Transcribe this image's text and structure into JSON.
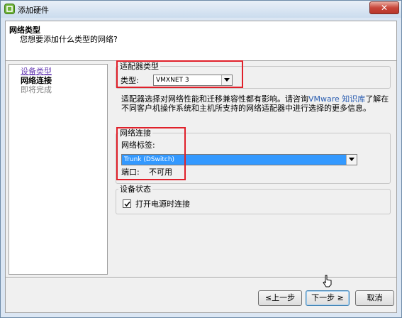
{
  "window": {
    "title": "添加硬件",
    "close_label": "✕"
  },
  "header": {
    "title": "网络类型",
    "subtitle": "您想要添加什么类型的网络?"
  },
  "nav": {
    "items": [
      {
        "label": "设备类型",
        "state": "link"
      },
      {
        "label": "网络连接",
        "state": "current"
      },
      {
        "label": "即将完成",
        "state": "disabled"
      }
    ]
  },
  "adapter": {
    "group_label": "适配器类型",
    "type_label": "类型:",
    "type_value": "VMXNET 3"
  },
  "description": {
    "part1": "适配器选择对网络性能和迁移兼容性都有影响。请咨询",
    "link": "VMware 知识库",
    "part2": "了解在不同客户机操作系统和主机所支持的网络适配器中进行选择的更多信息。"
  },
  "network": {
    "group_label": "网络连接",
    "label_label": "网络标签:",
    "label_value": "Trunk (DSwitch)",
    "port_label": "端口:",
    "port_value": "不可用"
  },
  "device_status": {
    "group_label": "设备状态",
    "power_on_label": "打开电源时连接",
    "power_on_checked": true
  },
  "buttons": {
    "back": "≤上一步",
    "next": "下一步 ≥",
    "cancel": "取消"
  },
  "colors": {
    "highlight_box": "#e0202a",
    "selection": "#3399ff",
    "link": "#2a5db0"
  }
}
